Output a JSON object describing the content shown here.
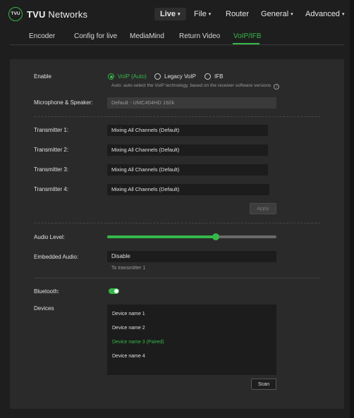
{
  "brand": {
    "logo_mark": "TVU",
    "name_bold": "TVU",
    "name_rest": " Networks"
  },
  "topnav": {
    "items": [
      {
        "label": "Live",
        "caret": "▾"
      },
      {
        "label": "File",
        "caret": "▾"
      },
      {
        "label": "Router"
      },
      {
        "label": "General",
        "caret": "▾"
      },
      {
        "label": "Advanced",
        "caret": "▾"
      }
    ],
    "active": "Live"
  },
  "tabs": {
    "items": [
      "Encoder",
      "Config for live",
      "MediaMind",
      "Return Video",
      "VoIP/IFB"
    ],
    "active": "VoIP/IFB"
  },
  "enable": {
    "label": "Enable",
    "options": [
      "VoIP (Auto)",
      "Legacy VoIP",
      "IFB"
    ],
    "selected": "VoIP (Auto)",
    "hint": "Auto: auto-select the VoIP technology, based on the receiver software versions"
  },
  "mic": {
    "label": "Microphone & Speaker:",
    "value": "Default - UMC404HD 192k"
  },
  "transmitters": [
    {
      "label": "Transmitter 1:",
      "value": "Mixing All Channels (Default)"
    },
    {
      "label": "Transmitter 2:",
      "value": "Mixing All Channels (Default)"
    },
    {
      "label": "Transmitter 3:",
      "value": "Mixing All Channels (Default)"
    },
    {
      "label": "Transmitter 4:",
      "value": "Mixing All Channels (Default)"
    }
  ],
  "apply_label": "Apply",
  "audio_level": {
    "label": "Audio Level:",
    "value_fraction": 0.64
  },
  "embedded_audio": {
    "label": "Embedded Audio:",
    "value": "Disable",
    "hint": "To transmitter 1"
  },
  "bluetooth": {
    "label": "Bluetooth:",
    "enabled": true
  },
  "devices": {
    "label": "Devices",
    "items": [
      {
        "name": "Device name 1",
        "paired": false
      },
      {
        "name": "Device name 2",
        "paired": false
      },
      {
        "name": "Device name 3 (Paired)",
        "paired": true
      },
      {
        "name": "Device name 4",
        "paired": false
      }
    ]
  },
  "scan_label": "Scan",
  "colors": {
    "accent": "#35b84a",
    "background": "#1e1e1e",
    "panel": "#2a2a2a"
  },
  "icons": [
    "logo-icon",
    "caret-down-icon",
    "info-icon",
    "toggle-icon"
  ]
}
